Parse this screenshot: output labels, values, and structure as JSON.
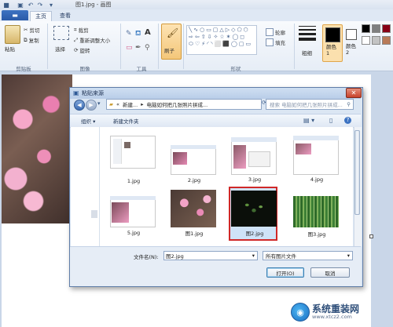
{
  "window": {
    "title": "图1.jpg - 画图"
  },
  "ribbon": {
    "file_tab": "▬",
    "tabs": [
      {
        "label": "主页"
      },
      {
        "label": "查看"
      }
    ],
    "clipboard": {
      "paste": "粘贴",
      "cut": "剪切",
      "copy": "复制",
      "label": "剪贴板"
    },
    "image": {
      "select": "选择",
      "crop": "裁剪",
      "resize": "重新调整大小",
      "rotate": "旋转",
      "label": "图像"
    },
    "tools": {
      "label": "工具",
      "text_tool": "A"
    },
    "brushes": {
      "label": "刷子"
    },
    "shapes": {
      "label": "形状",
      "outline": "轮廓",
      "fill": "填充"
    },
    "size": {
      "label": "粗细"
    },
    "color1": {
      "label": "颜色\n1",
      "value": "#000000"
    },
    "color2": {
      "label": "颜色\n2",
      "value": "#ffffff"
    },
    "palette": [
      "#000000",
      "#7f7f7f",
      "#880015",
      "#ffffff",
      "#c3c3c3",
      "#b97a57"
    ]
  },
  "dialog": {
    "title": "粘贴来源",
    "address": [
      "新建...",
      "电脑如何把几张照片拼成..."
    ],
    "search_placeholder": "搜索 电脑如何把几张照片拼成...",
    "organize": "组织 ▾",
    "new_folder": "新建文件夹",
    "files": [
      {
        "name": "1.jpg",
        "kind": "screenshot"
      },
      {
        "name": "2.jpg",
        "kind": "screenshot"
      },
      {
        "name": "3.jpg",
        "kind": "screenshot"
      },
      {
        "name": "4.jpg",
        "kind": "screenshot"
      },
      {
        "name": "5.jpg",
        "kind": "screenshot"
      },
      {
        "name": "图1.jpg",
        "kind": "blossom"
      },
      {
        "name": "图2.jpg",
        "kind": "orchid"
      },
      {
        "name": "图3.jpg",
        "kind": "bamboo"
      }
    ],
    "selected_file": "图2.jpg",
    "filename_label": "文件名(N):",
    "filename_value": "图2.jpg",
    "filetype_value": "所有图片文件",
    "open_button": "打开(O)",
    "cancel_button": "取消"
  },
  "watermark": {
    "title": "系统重装网",
    "url": "www.xtcz2.com"
  }
}
